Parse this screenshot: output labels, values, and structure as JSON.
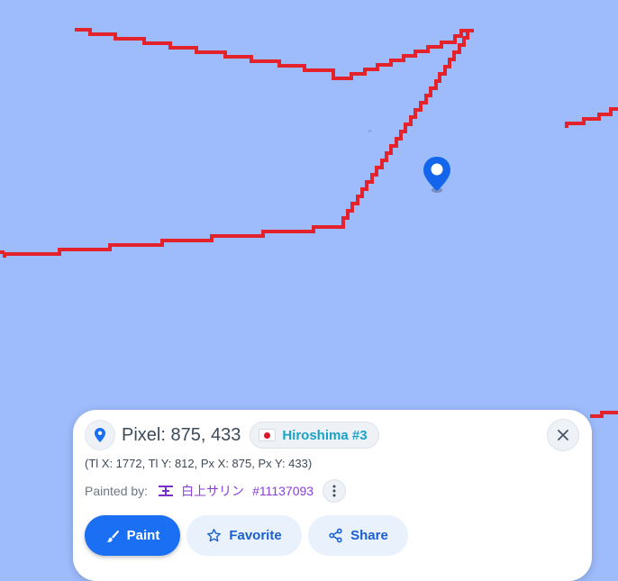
{
  "pixel_info": {
    "pixel_label": "Pixel: 875, 433",
    "region_chip": "Hiroshima #3",
    "coords_line": "(Tl X: 1772, Tl Y: 812, Px X: 875, Px Y: 433)",
    "painted_by_label": "Painted by:",
    "painter_name": "白上サリン",
    "painter_id": "#11137093"
  },
  "actions": {
    "paint_label": "Paint",
    "favorite_label": "Favorite",
    "share_label": "Share"
  },
  "icons": [
    "map-pin-icon",
    "japan-flag-icon",
    "close-icon",
    "user-flag-icon",
    "more-vertical-icon",
    "paintbrush-icon",
    "star-icon",
    "share-icon"
  ],
  "colors": {
    "map_background": "#9ebcfc",
    "border_line": "#e3222b",
    "accent": "#1a6ff2",
    "region_chip_text": "#1aa3c9",
    "painter_text": "#8a3fd8"
  }
}
